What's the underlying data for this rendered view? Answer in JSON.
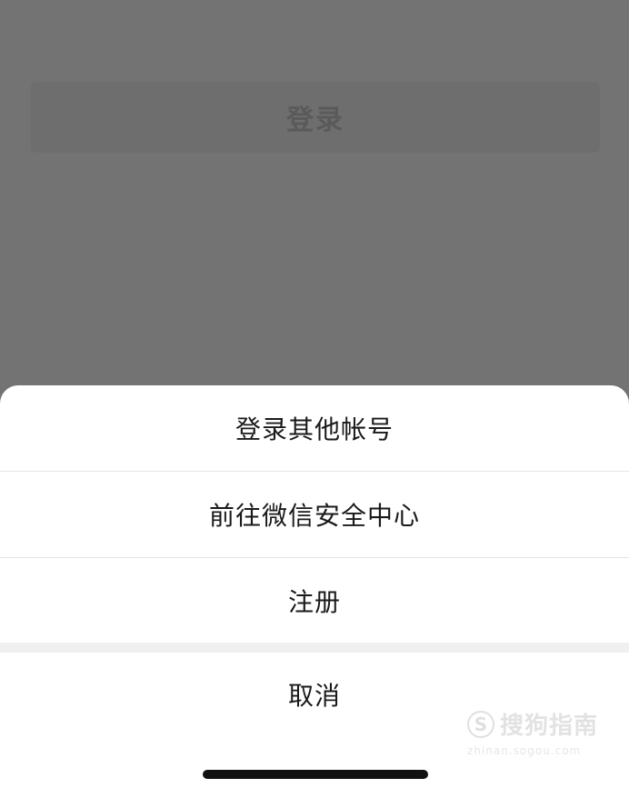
{
  "background_screen": {
    "login_button_label": "登录"
  },
  "action_sheet": {
    "items": [
      {
        "label": "登录其他帐号"
      },
      {
        "label": "前往微信安全中心"
      },
      {
        "label": "注册"
      }
    ],
    "cancel_label": "取消"
  },
  "watermark": {
    "logo_letter": "S",
    "brand_text": "搜狗指南",
    "url_text": "zhinan.sogou.com"
  },
  "colors": {
    "overlay": "#737373",
    "sheet_background": "#ffffff",
    "divider": "#e5e5e5",
    "gap": "#f0f0f0",
    "text": "#1a1a1a"
  }
}
